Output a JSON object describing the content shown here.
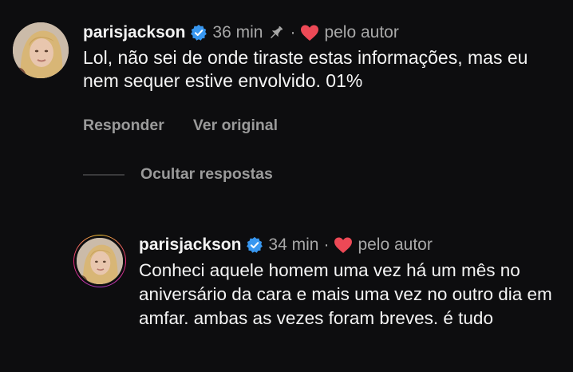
{
  "comment1": {
    "username": "parisjackson",
    "time": "36 min",
    "separator": "·",
    "liked_label": "pelo autor",
    "text": "Lol, não sei de onde tiraste estas informações, mas eu nem sequer estive envolvido. 01%",
    "actions": {
      "reply": "Responder",
      "see_original": "Ver original"
    }
  },
  "hide_replies": "Ocultar respostas",
  "comment2": {
    "username": "parisjackson",
    "time": "34 min",
    "separator": "·",
    "liked_label": "pelo autor",
    "text": "Conheci aquele homem uma vez há um mês no aniversário da cara e mais uma vez no outro dia em amfar. ambas as vezes foram breves. é tudo"
  },
  "colors": {
    "background": "#0d0d0f",
    "verified": "#3897f0",
    "heart": "#ed4956",
    "muted": "#a8a8a8"
  },
  "icons": [
    "verified-badge-icon",
    "pin-icon",
    "heart-icon"
  ]
}
